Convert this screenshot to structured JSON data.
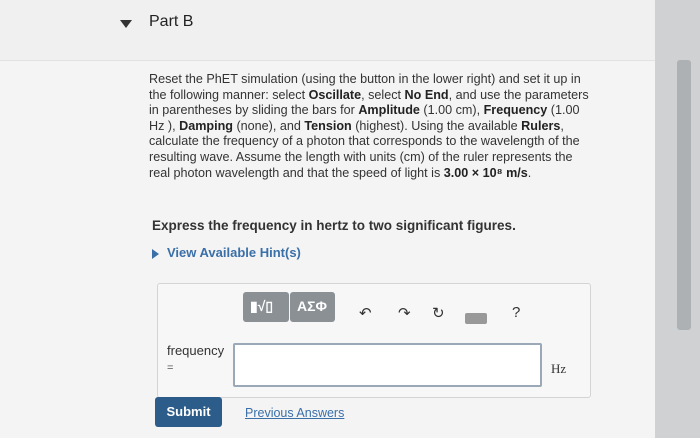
{
  "part": {
    "title": "Part B"
  },
  "problem": {
    "t1": "Reset the PhET simulation (using the button in the lower right) and set it up in the following manner: select ",
    "oscillate": "Oscillate",
    "t2": ", select ",
    "noend": "No End",
    "t3": ", and use the parameters in parentheses by sliding the bars for ",
    "amplitude": "Amplitude",
    "t4": " (1.00 cm), ",
    "frequency": "Frequency",
    "t5": " (1.00 Hz ), ",
    "damping": "Damping",
    "t6": " (none), and ",
    "tension": "Tension",
    "t7": " (highest). Using the available ",
    "rulers": "Rulers",
    "t8": ", calculate the frequency of a photon that corresponds to the wavelength of the resulting wave. Assume the length with units (cm) of the ruler represents the real photon wavelength and that the speed of light is ",
    "speed": "3.00 × 10⁸ m/s",
    "t9": "."
  },
  "instruction": "Express the frequency in hertz to two significant figures.",
  "hint_link": "View Available Hint(s)",
  "toolbar": {
    "templates_label": "▮√▯",
    "symbols_label": "ΑΣΦ",
    "undo_icon": "↶",
    "redo_icon": "↷",
    "reset_icon": "↻",
    "keyboard_icon": "keyboard-icon",
    "help_label": "?"
  },
  "answer": {
    "label": "frequency",
    "equals": "=",
    "value": "",
    "unit": "Hz"
  },
  "submit_label": "Submit",
  "previous_answers_label": "Previous Answers"
}
